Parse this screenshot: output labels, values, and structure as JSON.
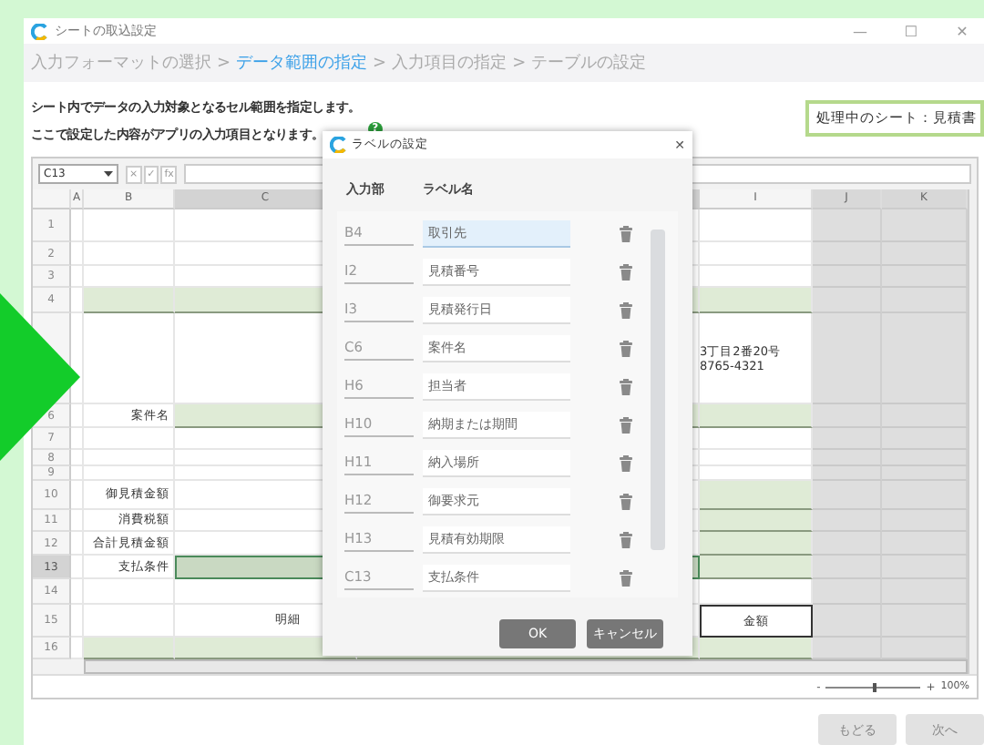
{
  "window": {
    "title": "シートの取込設定",
    "controls": [
      "—",
      "☐",
      "✕"
    ]
  },
  "steps": [
    {
      "label": "入力フォーマットの選択",
      "selected": false
    },
    {
      "label": "データ範囲の指定",
      "selected": true
    },
    {
      "label": "入力項目の指定",
      "selected": false
    },
    {
      "label": "テーブルの設定",
      "selected": false
    }
  ],
  "step_separator": ">",
  "description": [
    "シート内でデータの入力対象となるセル範囲を指定します。",
    "ここで設定した内容がアプリの入力項目となります。"
  ],
  "help": "?",
  "sheet_badge": "処理中のシート：見積書",
  "formula_bar": {
    "name_box": "C13",
    "buttons": [
      "×",
      "✓",
      "fx"
    ]
  },
  "columns": [
    "A",
    "B",
    "C",
    "I",
    "J",
    "K"
  ],
  "rows": [
    {
      "header": "1",
      "selected": false
    },
    {
      "header": "2",
      "selected": false
    },
    {
      "header": "3",
      "selected": false
    },
    {
      "header": "4",
      "selected": false
    },
    {
      "selected": false,
      "value_lines": [
        "3丁目2番20号",
        "8765-4321"
      ]
    },
    {
      "header": "6",
      "selected": false,
      "label": "案件名"
    },
    {
      "header": "7",
      "selected": false
    },
    {
      "header": "8",
      "selected": false
    },
    {
      "header": "9",
      "selected": false
    },
    {
      "header": "10",
      "selected": false,
      "label": "御見積金額"
    },
    {
      "header": "11",
      "selected": false,
      "label": "消費税額"
    },
    {
      "header": "12",
      "selected": false,
      "label": "合計見積金額"
    },
    {
      "header": "13",
      "selected": true,
      "label": "支払条件"
    },
    {
      "header": "14",
      "selected": false
    },
    {
      "header": "15",
      "selected": false,
      "detail": "明細",
      "value": "金額"
    },
    {
      "header": "16",
      "selected": false
    }
  ],
  "zoom": {
    "minus": "-",
    "plus": "+",
    "level": 0.5,
    "reading": "100%"
  },
  "dialog": {
    "title": "ラベルの設定",
    "close": "✕",
    "headers": [
      "入力部",
      "ラベル名"
    ],
    "items": [
      {
        "cell": "B4",
        "label": "取引先",
        "selected": true
      },
      {
        "cell": "I2",
        "label": "見積番号",
        "selected": false
      },
      {
        "cell": "I3",
        "label": "見積発行日",
        "selected": false
      },
      {
        "cell": "C6",
        "label": "案件名",
        "selected": false
      },
      {
        "cell": "H6",
        "label": "担当者",
        "selected": false
      },
      {
        "cell": "H10",
        "label": "納期または期間",
        "selected": false
      },
      {
        "cell": "H11",
        "label": "納入場所",
        "selected": false
      },
      {
        "cell": "H12",
        "label": "御要求元",
        "selected": false
      },
      {
        "cell": "H13",
        "label": "見積有効期限",
        "selected": false
      },
      {
        "cell": "C13",
        "label": "支払条件",
        "selected": false
      }
    ],
    "buttons": [
      "OK",
      "キャンセル"
    ]
  },
  "nav_buttons": [
    {
      "label": "もどる",
      "disabled": true
    },
    {
      "label": "次へ",
      "disabled": true
    }
  ]
}
